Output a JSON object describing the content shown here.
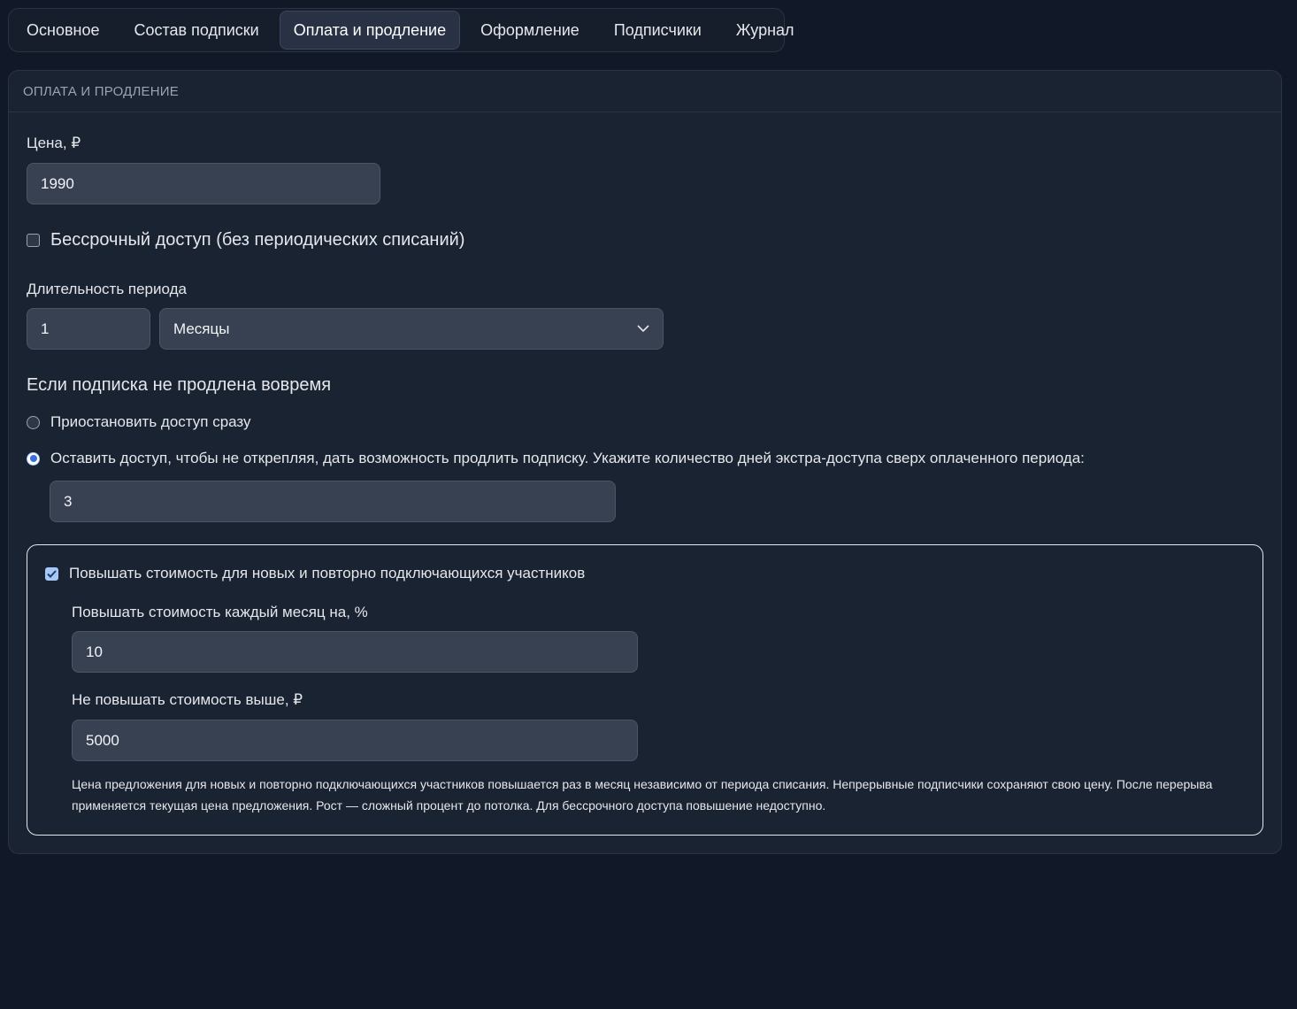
{
  "tabs": [
    {
      "label": "Основное",
      "active": false
    },
    {
      "label": "Состав подписки",
      "active": false
    },
    {
      "label": "Оплата и продление",
      "active": true
    },
    {
      "label": "Оформление",
      "active": false
    },
    {
      "label": "Подписчики",
      "active": false
    },
    {
      "label": "Журнал",
      "active": false
    }
  ],
  "section": {
    "title": "ОПЛАТА И ПРОДЛЕНИЕ",
    "price": {
      "label": "Цена, ₽",
      "value": "1990"
    },
    "lifetime": {
      "label": "Бессрочный доступ (без периодических списаний)",
      "checked": false
    },
    "period": {
      "label": "Длительность периода",
      "count": "1",
      "unit": "Месяцы"
    },
    "lapse": {
      "heading": "Если подписка не продлена вовремя",
      "option_suspend": "Приостановить доступ сразу",
      "option_grace": "Оставить доступ, чтобы не открепляя, дать возможность продлить подписку. Укажите количество дней экстра-доступа сверх оплаченного периода:",
      "selected": "grace",
      "grace_days": "3"
    },
    "price_increase": {
      "label": "Повышать стоимость для новых и повторно подключающихся участников",
      "checked": true,
      "percent_label": "Повышать стоимость каждый месяц на, %",
      "percent_value": "10",
      "cap_label": "Не повышать стоимость выше, ₽",
      "cap_value": "5000",
      "note": "Цена предложения для новых и повторно подключающихся участников повышается раз в месяц независимо от периода списания. Непрерывные подписчики сохраняют свою цену. После перерыва применяется текущая цена предложения. Рост — сложный процент до потолка. Для бессрочного доступа повышение недоступно."
    }
  }
}
